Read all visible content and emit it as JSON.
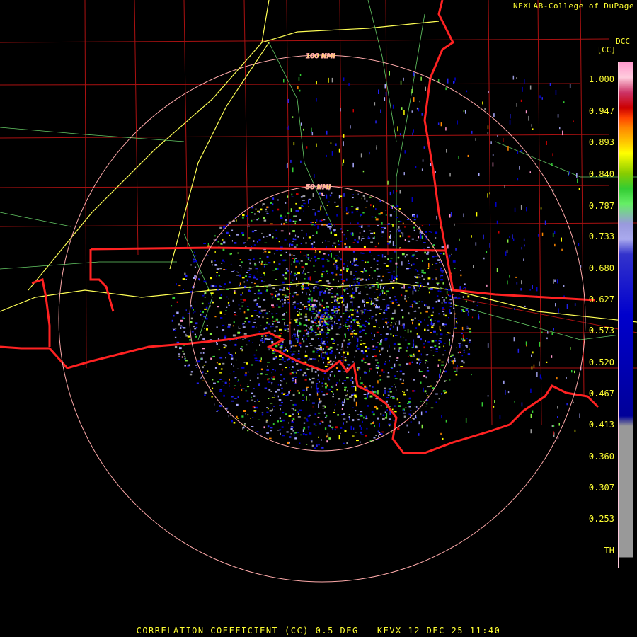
{
  "header": {
    "credit": "NEXLAB-College of DuPage",
    "product_tag": "DCC",
    "unit_tag": "[CC]"
  },
  "footer": {
    "caption": "CORRELATION COEFFICIENT (CC) 0.5 DEG - KEVX 12 DEC 25 11:40"
  },
  "range_rings": [
    {
      "label": "50 NMI"
    },
    {
      "label": "100 NMI"
    }
  ],
  "colorbar": {
    "ticks": [
      "1.000",
      "0.947",
      "0.893",
      "0.840",
      "0.787",
      "0.733",
      "0.680",
      "0.627",
      "0.573",
      "0.520",
      "0.467",
      "0.413",
      "0.360",
      "0.307",
      "0.253",
      "TH"
    ],
    "colors": {
      "pink": "#ff99cc",
      "red": "#cc0000",
      "orange": "#ff8800",
      "yellow": "#ffff00",
      "green": "#33cc33",
      "lavender": "#9999dd",
      "blue": "#0000cc",
      "gray": "#999999",
      "black": "#000000"
    }
  },
  "map_colors": {
    "state_border": "#ff2222",
    "county_border": "#aa1111",
    "highway": "#ffff55",
    "road": "#66cc66",
    "range_ring": "#ffaaaa"
  }
}
